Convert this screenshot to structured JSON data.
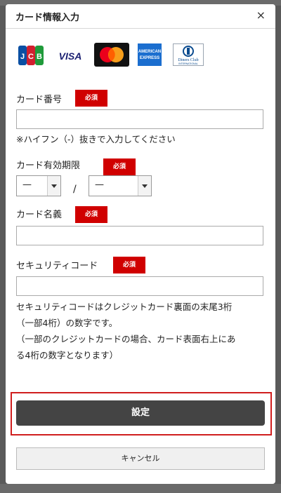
{
  "dialog": {
    "title": "カード情報入力",
    "close_label": "×"
  },
  "brands": [
    {
      "name": "JCB",
      "icon": "jcb-logo"
    },
    {
      "name": "VISA",
      "icon": "visa-logo"
    },
    {
      "name": "Mastercard",
      "icon": "mastercard-logo"
    },
    {
      "name": "AMERICAN EXPRESS",
      "icon": "amex-logo"
    },
    {
      "name": "Diners Club INTERNATIONAL",
      "icon": "diners-logo"
    }
  ],
  "required_badge": "必須",
  "fields": {
    "card_number": {
      "label": "カード番号",
      "value": "",
      "placeholder": "",
      "note": "※ハイフン（-）抜きで入力してください"
    },
    "expiry": {
      "label": "カード有効期限",
      "month": "—",
      "year": "—",
      "separator": "/"
    },
    "card_name": {
      "label": "カード名義",
      "value": ""
    },
    "security_code": {
      "label": "セキュリティコード",
      "value": "",
      "note_lines": [
        "セキュリティコードはクレジットカード裏面の末尾3桁",
        "（一部4桁）の数字です。",
        "（一部のクレジットカードの場合、カード表面右上にあ",
        "る4桁の数字となります）"
      ]
    }
  },
  "buttons": {
    "submit": "設定",
    "cancel": "キャンセル"
  },
  "colors": {
    "required": "#d00000",
    "submit_bg": "#444444",
    "highlight": "#d01e1e"
  }
}
